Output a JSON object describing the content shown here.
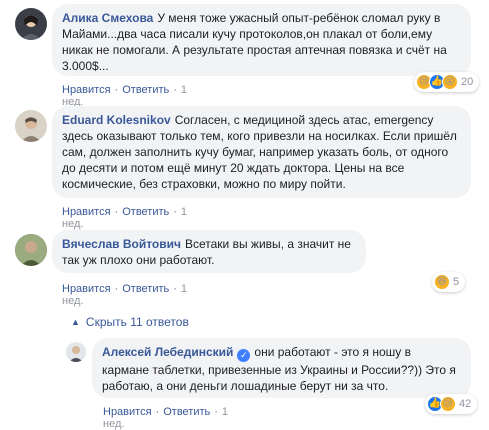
{
  "comments": [
    {
      "author": "Алика Смехова",
      "text": "У меня тоже ужасный опыт-ребёнок сломал руку в Майами...два часа писали кучу протоколов,он плакал от боли,ему никак не помогали. А результате простая аптечная повязка и счёт на 3.000$...",
      "like_label": "Нравится",
      "reply_label": "Ответить",
      "time": "1 нед.",
      "reaction_count": "20",
      "reaction_icons": [
        "sad-reaction-icon",
        "like-reaction-icon",
        "wow-reaction-icon"
      ]
    },
    {
      "author": "Eduard Kolesnikov",
      "text": "Согласен, с медициной здесь атас, emergency здесь оказывают только тем, кого привезли на носилках. Если пришёл сам, должен заполнить кучу бумаг, например указать боль, от одного до десяти и потом ещё минут 20 ждать доктора. Цены на все космические, без страховки, можно по миру пойти.",
      "like_label": "Нравится",
      "reply_label": "Ответить",
      "time": "1 нед."
    },
    {
      "author": "Вячеслав Войтович",
      "text": "Всетаки вы живы, а значит не так уж плохо они работают.",
      "like_label": "Нравится",
      "reply_label": "Ответить",
      "time": "1 нед.",
      "reaction_count": "5",
      "reaction_icons": [
        "haha-reaction-icon"
      ]
    },
    {
      "author": "Алексей Лебединский",
      "text": "они работают - это я ношу в кармане таблетки, привезенные из Украины и России??)) Это я работаю, а они деньги лошадиные берут ни за что.",
      "like_label": "Нравится",
      "reply_label": "Ответить",
      "time": "1 нед.",
      "reaction_count": "42",
      "reaction_icons": [
        "like-reaction-icon",
        "sad-reaction-icon"
      ]
    }
  ],
  "hide_replies_label": "Скрыть 11 ответов",
  "colors": {
    "link": "#385898",
    "bubble": "#f2f3f5",
    "like_reaction": "#1877f2",
    "emoji_reaction": "#f7b125"
  }
}
